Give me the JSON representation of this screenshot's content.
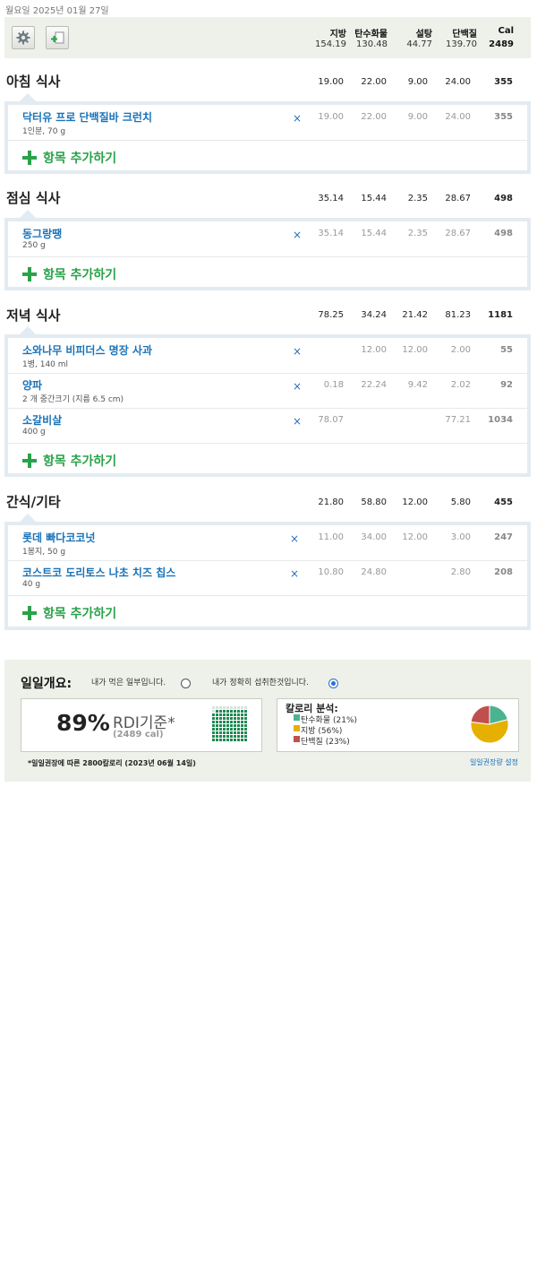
{
  "date_label": "월요일 2025년 01월 27일",
  "toolbar": {
    "settings_icon": "gear-icon",
    "add_icon": "add-entry-icon"
  },
  "columns": {
    "fat": "지방",
    "carbs": "탄수화물",
    "sugar": "설탕",
    "protein": "단백질",
    "cal": "Cal"
  },
  "totals": {
    "fat": "154.19",
    "carbs": "130.48",
    "sugar": "44.77",
    "protein": "139.70",
    "cal": "2489"
  },
  "add_item_label": "항목 추가하기",
  "delete_glyph": "×",
  "meals": [
    {
      "title": "아침 식사",
      "totals": {
        "fat": "19.00",
        "carbs": "22.00",
        "sugar": "9.00",
        "protein": "24.00",
        "cal": "355"
      },
      "items": [
        {
          "name": "닥터유 프로 단백질바 크런치",
          "qty": "1인분, 70 g",
          "fat": "19.00",
          "carbs": "22.00",
          "sugar": "9.00",
          "protein": "24.00",
          "cal": "355"
        }
      ]
    },
    {
      "title": "점심 식사",
      "totals": {
        "fat": "35.14",
        "carbs": "15.44",
        "sugar": "2.35",
        "protein": "28.67",
        "cal": "498"
      },
      "items": [
        {
          "name": "동그랑땡",
          "qty": "250 g",
          "fat": "35.14",
          "carbs": "15.44",
          "sugar": "2.35",
          "protein": "28.67",
          "cal": "498"
        }
      ]
    },
    {
      "title": "저녁 식사",
      "totals": {
        "fat": "78.25",
        "carbs": "34.24",
        "sugar": "21.42",
        "protein": "81.23",
        "cal": "1181"
      },
      "items": [
        {
          "name": "소와나무 비피더스 명장 사과",
          "qty": "1병, 140 ml",
          "fat": "",
          "carbs": "12.00",
          "sugar": "12.00",
          "protein": "2.00",
          "cal": "55"
        },
        {
          "name": "양파",
          "qty": "2 개 중간크기 (지름 6.5 cm)",
          "fat": "0.18",
          "carbs": "22.24",
          "sugar": "9.42",
          "protein": "2.02",
          "cal": "92"
        },
        {
          "name": "소갈비살",
          "qty": "400 g",
          "fat": "78.07",
          "carbs": "",
          "sugar": "",
          "protein": "77.21",
          "cal": "1034"
        }
      ]
    },
    {
      "title": "간식/기타",
      "totals": {
        "fat": "21.80",
        "carbs": "58.80",
        "sugar": "12.00",
        "protein": "5.80",
        "cal": "455"
      },
      "items": [
        {
          "name": "롯데 빠다코코넛",
          "qty": "1봉지, 50 g",
          "fat": "11.00",
          "carbs": "34.00",
          "sugar": "12.00",
          "protein": "3.00",
          "cal": "247"
        },
        {
          "name": "코스트코 도리토스 나초 치즈 칩스",
          "qty": "40 g",
          "fat": "10.80",
          "carbs": "24.80",
          "sugar": "",
          "protein": "2.80",
          "cal": "208"
        }
      ]
    }
  ],
  "overview": {
    "title": "일일개요:",
    "option_partial": "내가 먹은 일부입니다.",
    "option_full": "내가 정확히 섭취한것입니다.",
    "selected_option": "full",
    "rdi_percent": "89%",
    "rdi_percent_value": 89,
    "rdi_label": "RDI기준*",
    "rdi_cal": "(2489 cal)",
    "calorie_breakdown_title": "칼로리 분석:",
    "legend": [
      {
        "label": "탄수화물 (21%)",
        "percent": 21,
        "color": "#4bb391"
      },
      {
        "label": "지방 (56%)",
        "percent": 56,
        "color": "#e6b000"
      },
      {
        "label": "단백질 (23%)",
        "percent": 23,
        "color": "#c0504d"
      }
    ],
    "footnote": "*일일권장에 따른 2800칼로리 (2023년 06월 14일)",
    "settings_link": "일일권장량 설정"
  }
}
